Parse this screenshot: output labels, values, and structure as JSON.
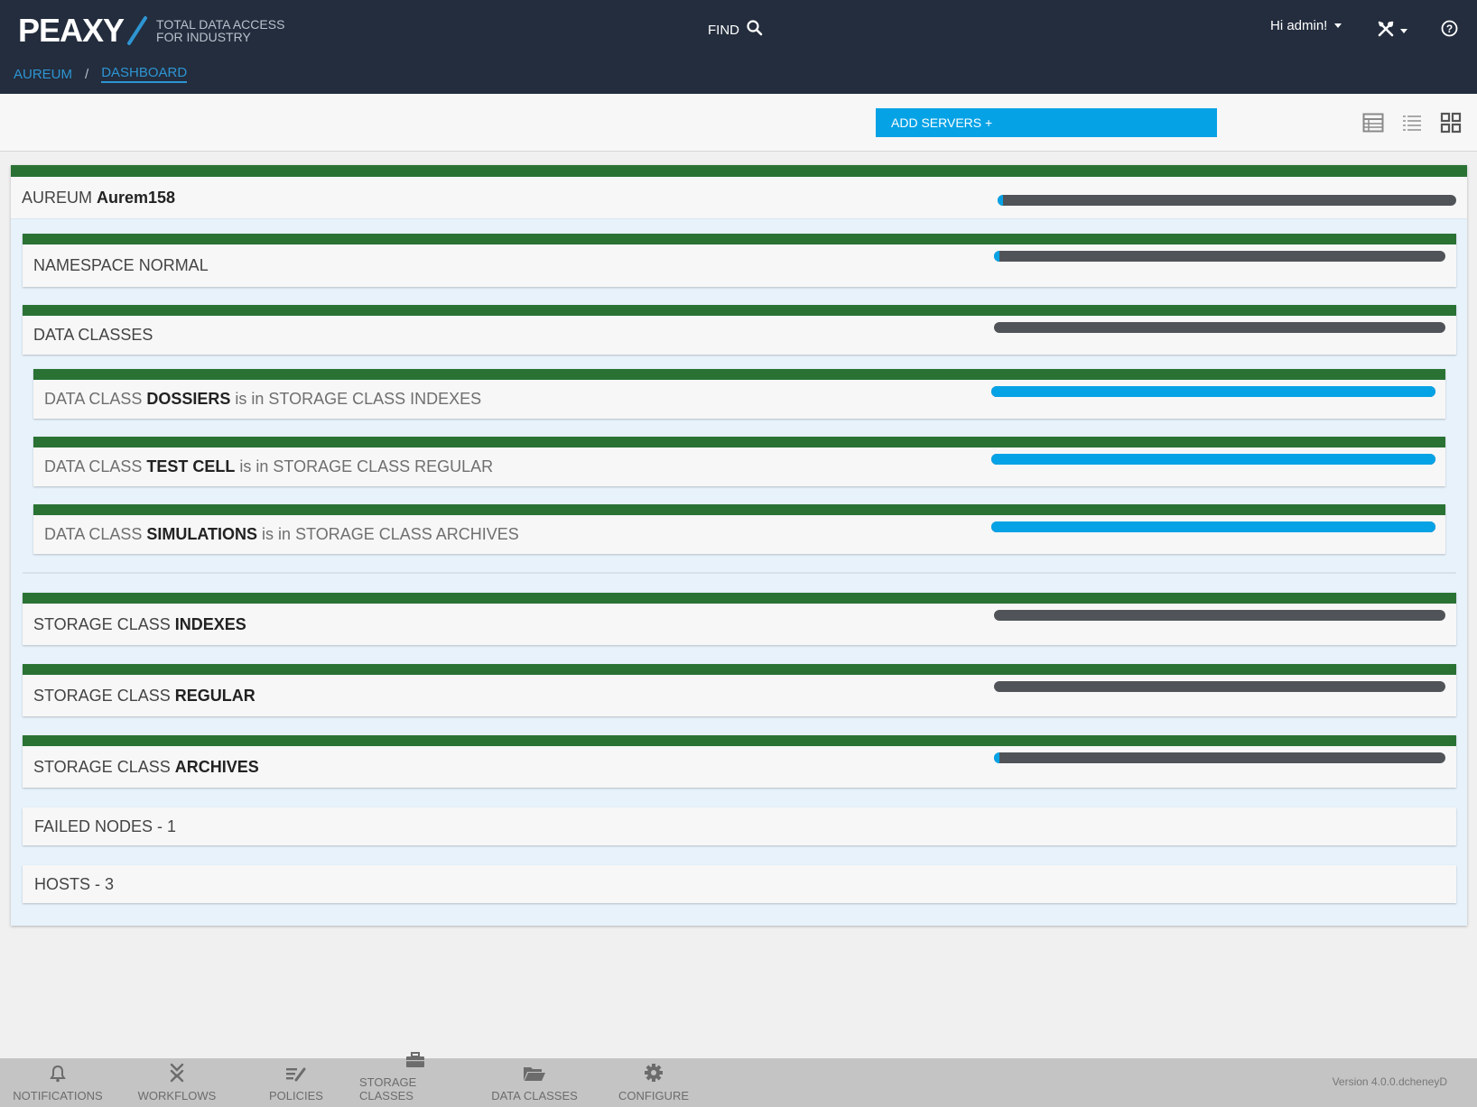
{
  "header": {
    "logo_text": "PEAXY",
    "tagline_line1": "TOTAL DATA ACCESS",
    "tagline_line2": "FOR INDUSTRY",
    "find_label": "FIND",
    "user_greeting": "Hi admin!"
  },
  "breadcrumb": {
    "root": "AUREUM",
    "separator": "/",
    "current": "DASHBOARD"
  },
  "toolbar": {
    "add_servers_label": "ADD SERVERS +"
  },
  "cluster": {
    "prefix": "AUREUM",
    "name": "Aurem158",
    "usage_fraction": 0.012
  },
  "namespace": {
    "label": "NAMESPACE NORMAL",
    "usage_fraction": 0.012
  },
  "data_classes": {
    "label": "DATA CLASSES",
    "usage_fraction": 0,
    "items": [
      {
        "prefix": "DATA CLASS",
        "name": "DOSSIERS",
        "mid": "is in",
        "storage": "STORAGE CLASS INDEXES",
        "usage_fraction": 1.0
      },
      {
        "prefix": "DATA CLASS",
        "name": "TEST CELL",
        "mid": "is in",
        "storage": "STORAGE CLASS REGULAR",
        "usage_fraction": 1.0
      },
      {
        "prefix": "DATA CLASS",
        "name": "SIMULATIONS",
        "mid": "is in",
        "storage": "STORAGE CLASS ARCHIVES",
        "usage_fraction": 1.0
      }
    ]
  },
  "storage_classes": [
    {
      "prefix": "STORAGE CLASS",
      "name": "INDEXES",
      "usage_fraction": 0
    },
    {
      "prefix": "STORAGE CLASS",
      "name": "REGULAR",
      "usage_fraction": 0
    },
    {
      "prefix": "STORAGE CLASS",
      "name": "ARCHIVES",
      "usage_fraction": 0.012
    }
  ],
  "failed_nodes": "FAILED NODES - 1",
  "hosts": "HOSTS - 3",
  "bottom_nav": {
    "items": [
      {
        "label": "NOTIFICATIONS",
        "icon": "bell-icon"
      },
      {
        "label": "WORKFLOWS",
        "icon": "workflows-icon"
      },
      {
        "label": "POLICIES",
        "icon": "policies-icon"
      },
      {
        "label": "STORAGE CLASSES",
        "icon": "briefcase-icon"
      },
      {
        "label": "DATA CLASSES",
        "icon": "folder-open-icon"
      },
      {
        "label": "CONFIGURE",
        "icon": "gear-icon"
      }
    ],
    "version": "Version 4.0.0.dcheneyD"
  },
  "colors": {
    "header_bg": "#232d3d",
    "accent_blue": "#06a2e6",
    "status_green": "#2a7234",
    "bar_gray": "#505458",
    "panel_bg": "#e7f2fb"
  }
}
